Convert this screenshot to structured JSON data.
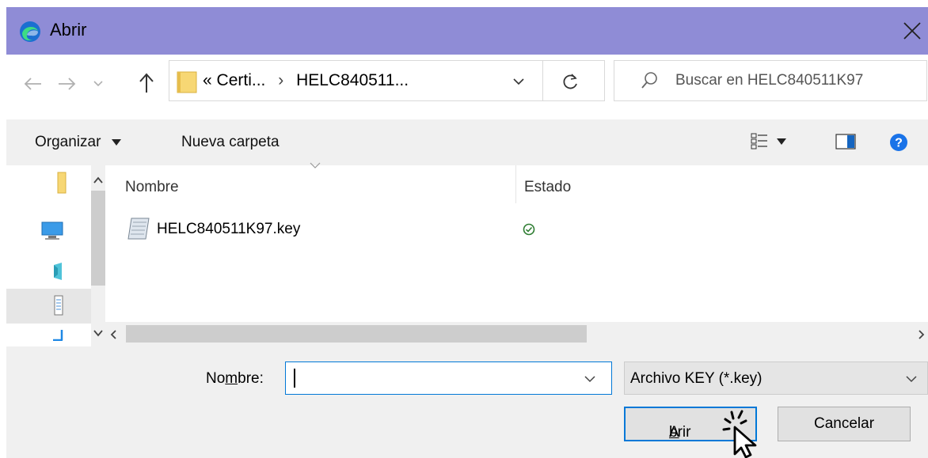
{
  "window": {
    "title": "Abrir",
    "app_icon": "edge-browser-icon",
    "close_icon": "close-icon"
  },
  "navigation": {
    "back_icon": "back-arrow-icon",
    "forward_icon": "forward-arrow-icon",
    "recent_icon": "chevron-down-icon",
    "up_icon": "up-arrow-icon",
    "address": {
      "overflow": "«",
      "segments": [
        "Certi...",
        "HELC840511..."
      ],
      "separator": "›"
    },
    "refresh_icon": "refresh-icon",
    "search_placeholder": "Buscar en HELC840511K97"
  },
  "toolbar": {
    "organize_label": "Organizar",
    "new_folder_label": "Nueva carpeta",
    "view_icon": "view-options-icon",
    "preview_icon": "preview-pane-icon",
    "help_icon": "help-icon"
  },
  "file_list": {
    "columns": [
      "Nombre",
      "Estado"
    ],
    "rows": [
      {
        "name": "HELC840511K97.key",
        "status_icon": "sync-check-icon"
      }
    ]
  },
  "footer": {
    "filename_label_pre": "No",
    "filename_label_mnemonic": "m",
    "filename_label_post": "bre:",
    "filename_value": "",
    "filter_value": "Archivo KEY (*.key)",
    "open_label_mnemonic": "A",
    "open_label_rest": "brir",
    "cancel_label": "Cancelar"
  },
  "colors": {
    "titlebar": "#8f8cd6",
    "accent": "#0078d7",
    "toolbar_bg": "#f0f0f0",
    "folder": "#f7d774",
    "status_green": "#2e7d32"
  }
}
